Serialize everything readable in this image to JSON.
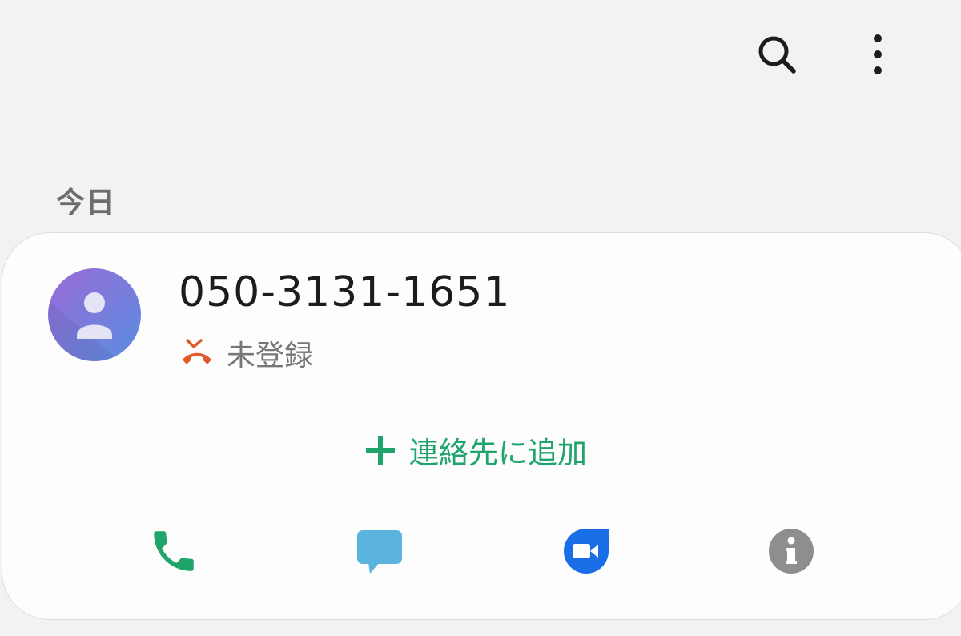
{
  "top_bar": {
    "search_icon": "search-icon",
    "more_icon": "more-vertical-icon"
  },
  "section": {
    "header": "今日"
  },
  "call_entry": {
    "number": "050-3131-1651",
    "status_icon": "missed-call-icon",
    "status_text": "未登録",
    "avatar_icon": "person-icon",
    "add_contact_label": "連絡先に追加"
  },
  "actions": [
    {
      "icon": "phone-icon"
    },
    {
      "icon": "message-icon"
    },
    {
      "icon": "video-call-icon"
    },
    {
      "icon": "info-icon"
    }
  ],
  "colors": {
    "background": "#f2f2f2",
    "card": "#fdfdfd",
    "accent_green": "#1fa46b",
    "missed_call_orange": "#e05a2a",
    "message_blue": "#5ab4de",
    "video_blue": "#1a6fe8",
    "info_gray": "#8e8e8e",
    "avatar_gradient_start": "#9a6ad8",
    "avatar_gradient_end": "#5a8ee0"
  }
}
